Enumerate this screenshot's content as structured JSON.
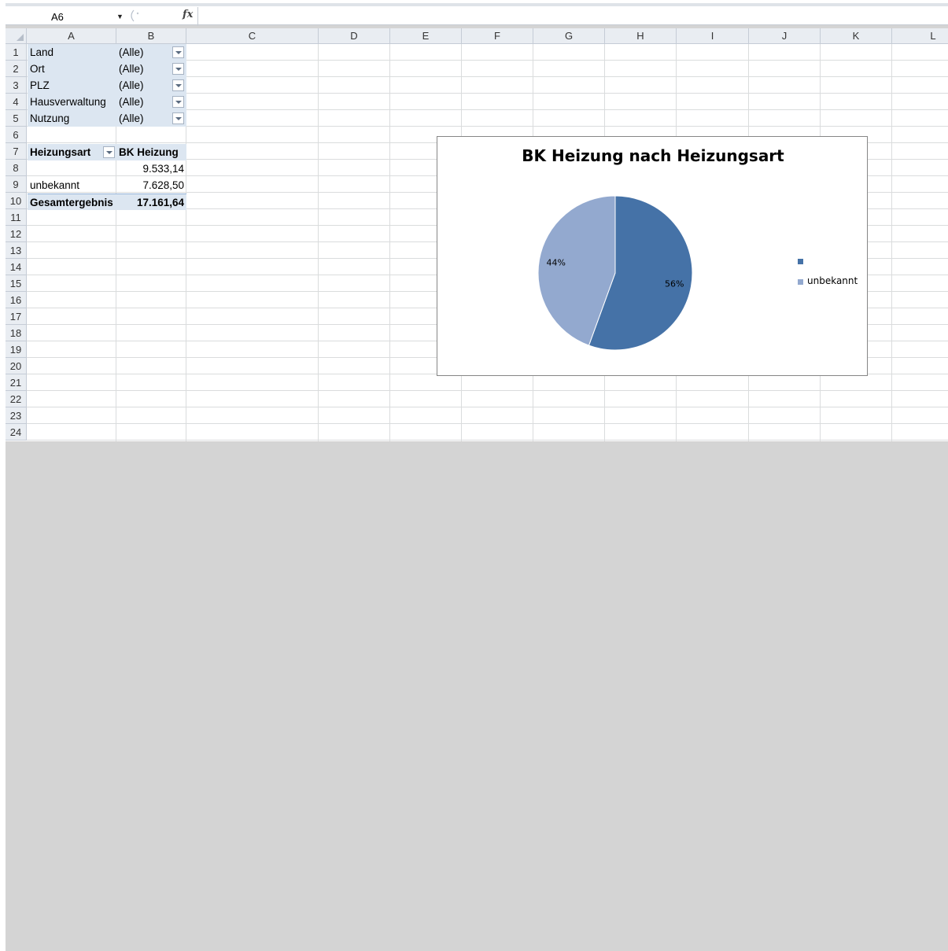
{
  "formula_bar": {
    "name_box": "A6",
    "formula": ""
  },
  "columns": [
    "A",
    "B",
    "C",
    "D",
    "E",
    "F",
    "G",
    "H",
    "I",
    "J",
    "K",
    "L"
  ],
  "rows": [
    "1",
    "2",
    "3",
    "4",
    "5",
    "6",
    "7",
    "8",
    "9",
    "10",
    "11",
    "12",
    "13",
    "14",
    "15",
    "16",
    "17",
    "18",
    "19",
    "20",
    "21",
    "22",
    "23",
    "24"
  ],
  "report_filters": [
    {
      "field": "Land",
      "value": "(Alle)"
    },
    {
      "field": "Ort",
      "value": "(Alle)"
    },
    {
      "field": "PLZ",
      "value": "(Alle)"
    },
    {
      "field": "Hausverwaltung",
      "value": "(Alle)"
    },
    {
      "field": "Nutzung",
      "value": "(Alle)"
    }
  ],
  "pivot": {
    "row_header": "Heizungsart",
    "value_header": "BK Heizung",
    "rows": [
      {
        "label": "",
        "value": "9.533,14"
      },
      {
        "label": "unbekannt",
        "value": "7.628,50"
      }
    ],
    "total_label": "Gesamtergebnis",
    "total_value": "17.161,64"
  },
  "chart_data": {
    "type": "pie",
    "title": "BK Heizung nach Heizungsart",
    "categories": [
      "",
      "unbekannt"
    ],
    "values": [
      9533.14,
      7628.5
    ],
    "data_labels": [
      "56%",
      "44%"
    ],
    "colors": [
      "#4572a7",
      "#93a9cf"
    ],
    "legend_position": "right"
  }
}
